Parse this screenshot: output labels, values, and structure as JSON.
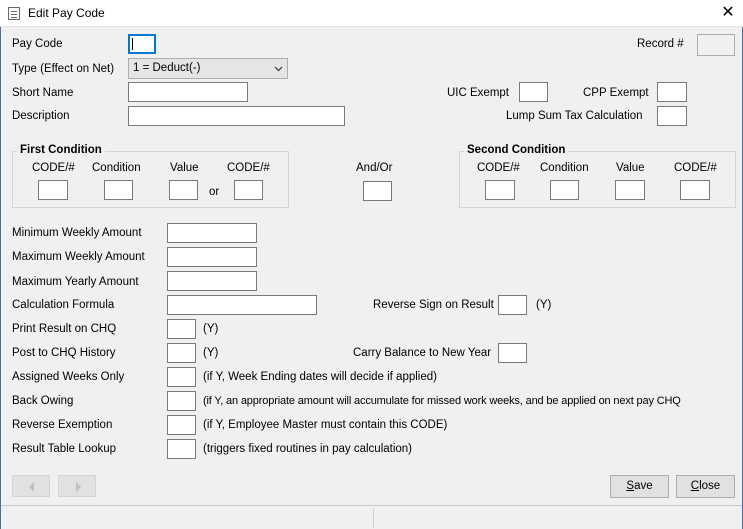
{
  "window": {
    "title": "Edit Pay Code"
  },
  "fields": {
    "pay_code_label": "Pay Code",
    "pay_code_value": "",
    "record_label": "Record #",
    "record_value": "",
    "type_label": "Type (Effect on Net)",
    "type_value": "1 = Deduct(-)",
    "short_name_label": "Short Name",
    "short_name_value": "",
    "description_label": "Description",
    "description_value": "",
    "uic_exempt_label": "UIC Exempt",
    "cpp_exempt_label": "CPP Exempt",
    "lump_sum_label": "Lump Sum Tax Calculation"
  },
  "first_condition": {
    "title": "First Condition",
    "code1_label": "CODE/#",
    "condition_label": "Condition",
    "value_label": "Value",
    "code2_label": "CODE/#",
    "or_label": "or"
  },
  "and_or": {
    "label": "And/Or"
  },
  "second_condition": {
    "title": "Second Condition",
    "code1_label": "CODE/#",
    "condition_label": "Condition",
    "value_label": "Value",
    "code2_label": "CODE/#"
  },
  "amounts": {
    "min_weekly_label": "Minimum Weekly Amount",
    "max_weekly_label": "Maximum Weekly Amount",
    "max_yearly_label": "Maximum Yearly Amount",
    "formula_label": "Calculation Formula",
    "reverse_sign_label": "Reverse Sign on Result",
    "reverse_sign_hint": "(Y)"
  },
  "flags": {
    "print_chq_label": "Print Result on CHQ",
    "print_chq_hint": "(Y)",
    "post_history_label": "Post to CHQ History",
    "post_history_hint": "(Y)",
    "carry_balance_label": "Carry Balance to New Year",
    "assigned_weeks_label": "Assigned Weeks Only",
    "assigned_weeks_hint": "(if Y, Week Ending dates will decide if applied)",
    "back_owing_label": "Back Owing",
    "back_owing_hint": "(if Y, an appropriate amount will accumulate for missed work weeks, and be applied on next pay CHQ",
    "reverse_exemption_label": "Reverse Exemption",
    "reverse_exemption_hint": "(if Y, Employee Master must contain this CODE)",
    "result_table_label": "Result Table Lookup",
    "result_table_hint": "(triggers fixed routines in pay calculation)"
  },
  "buttons": {
    "save_prefix": "",
    "save_accel": "S",
    "save_rest": "ave",
    "close_prefix": "",
    "close_accel": "C",
    "close_rest": "lose"
  },
  "icons": [
    "app-icon",
    "close-icon",
    "chevron-down-icon",
    "prev-arrow-icon",
    "next-arrow-icon"
  ]
}
